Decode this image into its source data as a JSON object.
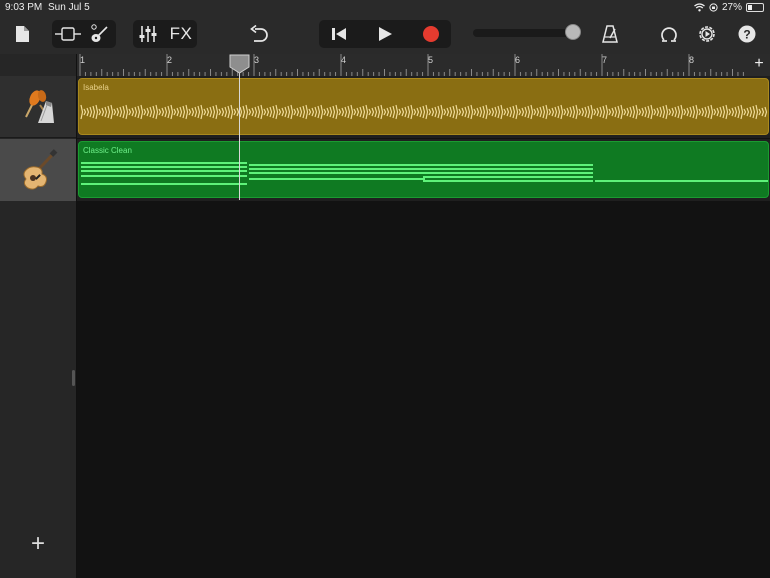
{
  "status_bar": {
    "time": "9:03 PM",
    "date": "Sun Jul 5",
    "battery": "27%"
  },
  "toolbar": {
    "fx_label": "FX"
  },
  "ruler": {
    "bars": [
      "1",
      "2",
      "3",
      "4",
      "5",
      "6",
      "7",
      "8"
    ],
    "add_symbol": "+"
  },
  "tracks": [
    {
      "instrument": "maracas-icon",
      "region_name": "Isabela",
      "region_type": "audio",
      "color": "#8a6e12"
    },
    {
      "instrument": "electric-guitar-icon",
      "region_name": "Classic Clean",
      "region_type": "midi",
      "color": "#0f7a22"
    }
  ],
  "add_track_symbol": "+",
  "colors": {
    "record": "#e53b2f",
    "background": "#121212",
    "toolbar": "#2a2a2a"
  },
  "playhead_bar": 3
}
